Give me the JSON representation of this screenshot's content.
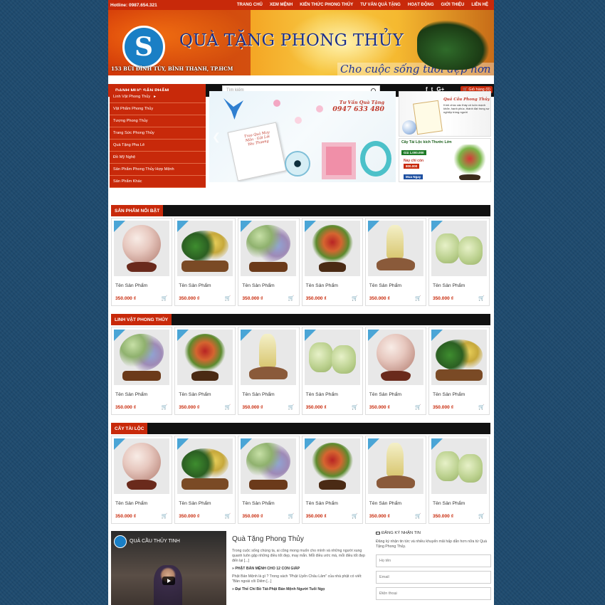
{
  "topbar": {
    "hotline": "Hotline: 0987.654.321",
    "nav": [
      "Trang chủ",
      "Xem mệnh",
      "Kiến thức phong thủy",
      "Tư vấn quà tặng",
      "Hoạt động",
      "Giới thiệu",
      "Liên hệ"
    ]
  },
  "banner": {
    "logo_glyph": "S",
    "title": "QUÀ TẶNG PHONG THỦY",
    "slogan": "Cho cuộc sống tươi đẹp hơn",
    "address": "153 BÙI ĐÌNH TÚY, BÌNH THẠNH, TP.HCM"
  },
  "navbar": {
    "category_heading": "DANH MỤC SẢN PHẨM",
    "search_placeholder": "Tìm kiếm",
    "socials": [
      "f",
      "t",
      "G+"
    ],
    "cart_label": "Giỏ hàng (0)"
  },
  "categories": [
    {
      "label": "Linh Vật Phong Thủy",
      "arrow": "►"
    },
    {
      "label": "Vật Phẩm Phong Thủy",
      "arrow": ""
    },
    {
      "label": "Tượng Phong Thủy",
      "arrow": ""
    },
    {
      "label": "Trang Sức Phong Thủy",
      "arrow": ""
    },
    {
      "label": "Quà Tặng Pha Lê",
      "arrow": ""
    },
    {
      "label": "Đồ Mỹ Nghệ",
      "arrow": ""
    },
    {
      "label": "Sản Phẩm Phong Thủy Hợp Mệnh",
      "arrow": ""
    },
    {
      "label": "Sản Phẩm Khác",
      "arrow": ""
    }
  ],
  "slider": {
    "ad_title": "Tư Vấn Quà Tặng",
    "ad_phone": "0947 633 480",
    "card_text": "Trao Quà May Mắn · Gửi Lời Yêu Thương",
    "prev": "❮"
  },
  "side_ads": {
    "ad1_title": "Quả Cầu Phong Thủy",
    "ad1_text": "Kính chúc các thầy cô luôn mạnh khỏe, hạnh phúc, thành đạt trong sự nghiệp trồng người",
    "ad2_title": "Cây Tài Lộc kích Thước Lớn",
    "ad2_old_price": "Giá 1.000.000",
    "ad2_now_label": "Nay chỉ còn",
    "ad2_new_price": "800.000",
    "ad2_buy": "Mua Ngay"
  },
  "sections": [
    {
      "title": "SẢN PHẨM NỔI BẬT",
      "products": [
        {
          "name": "Tên Sản Phẩm",
          "price": "350.000 ₫",
          "art": "sphere"
        },
        {
          "name": "Tên Sản Phẩm",
          "price": "350.000 ₫",
          "art": "tree1"
        },
        {
          "name": "Tên Sản Phẩm",
          "price": "350.000 ₫",
          "art": "tree2"
        },
        {
          "name": "Tên Sản Phẩm",
          "price": "350.000 ₫",
          "art": "tree3"
        },
        {
          "name": "Tên Sản Phẩm",
          "price": "350.000 ₫",
          "art": "crystal"
        },
        {
          "name": "Tên Sản Phẩm",
          "price": "350.000 ₫",
          "art": "jade"
        }
      ]
    },
    {
      "title": "LINH VẬT PHONG THỦY",
      "products": [
        {
          "name": "Tên Sản Phẩm",
          "price": "350.000 ₫",
          "art": "tree2"
        },
        {
          "name": "Tên Sản Phẩm",
          "price": "350.000 ₫",
          "art": "tree3"
        },
        {
          "name": "Tên Sản Phẩm",
          "price": "350.000 ₫",
          "art": "crystal"
        },
        {
          "name": "Tên Sản Phẩm",
          "price": "350.000 ₫",
          "art": "jade"
        },
        {
          "name": "Tên Sản Phẩm",
          "price": "350.000 ₫",
          "art": "sphere"
        },
        {
          "name": "Tên Sản Phẩm",
          "price": "350.000 ₫",
          "art": "tree1"
        }
      ]
    },
    {
      "title": "CÂY TÀI LỘC",
      "products": [
        {
          "name": "Tên Sản Phẩm",
          "price": "350.000 ₫",
          "art": "sphere"
        },
        {
          "name": "Tên Sản Phẩm",
          "price": "350.000 ₫",
          "art": "tree1"
        },
        {
          "name": "Tên Sản Phẩm",
          "price": "350.000 ₫",
          "art": "tree2"
        },
        {
          "name": "Tên Sản Phẩm",
          "price": "350.000 ₫",
          "art": "tree3"
        },
        {
          "name": "Tên Sản Phẩm",
          "price": "350.000 ₫",
          "art": "crystal"
        },
        {
          "name": "Tên Sản Phẩm",
          "price": "350.000 ₫",
          "art": "jade"
        }
      ]
    }
  ],
  "video": {
    "title": "QUẢ CẦU THỦY TINH"
  },
  "about": {
    "title": "Quà Tặng Phong Thủy",
    "intro": "Trong cuộc sống chúng ta, ai cũng mong muốn cho mình và những người xung quanh luôn gặp những điều tốt đẹp, may mắn. Mỗi điều ước mà, mỗi điều tốt đẹp đến lại [...]",
    "link1": "» PHẬT BẢN MỆNH CHO 12 CON GIÁP",
    "text1": "Phật Bản Mệnh là gì ? Trong sách \"Phật Uyển Châu Lâm\" của nhà phật có viết: \"Bản ngoài cõi Diêm [...]",
    "link2": "» Đại Thế Chí Bồ Tát-Phật Bản Mệnh Người Tuổi Ngọ"
  },
  "signup": {
    "heading": "ĐĂNG KÝ NHẬN TIN",
    "desc": "Đăng ký nhận tin tức và nhiều khuyến mãi hấp dẫn hơn nữa từ Quà Tặng Phong Thủy.",
    "name_placeholder": "Họ tên",
    "email_placeholder": "Email",
    "phone_placeholder": "Điện thoại"
  },
  "colors": {
    "accent": "#c8290a",
    "dark": "#111111",
    "background": "#1e4a6e"
  }
}
